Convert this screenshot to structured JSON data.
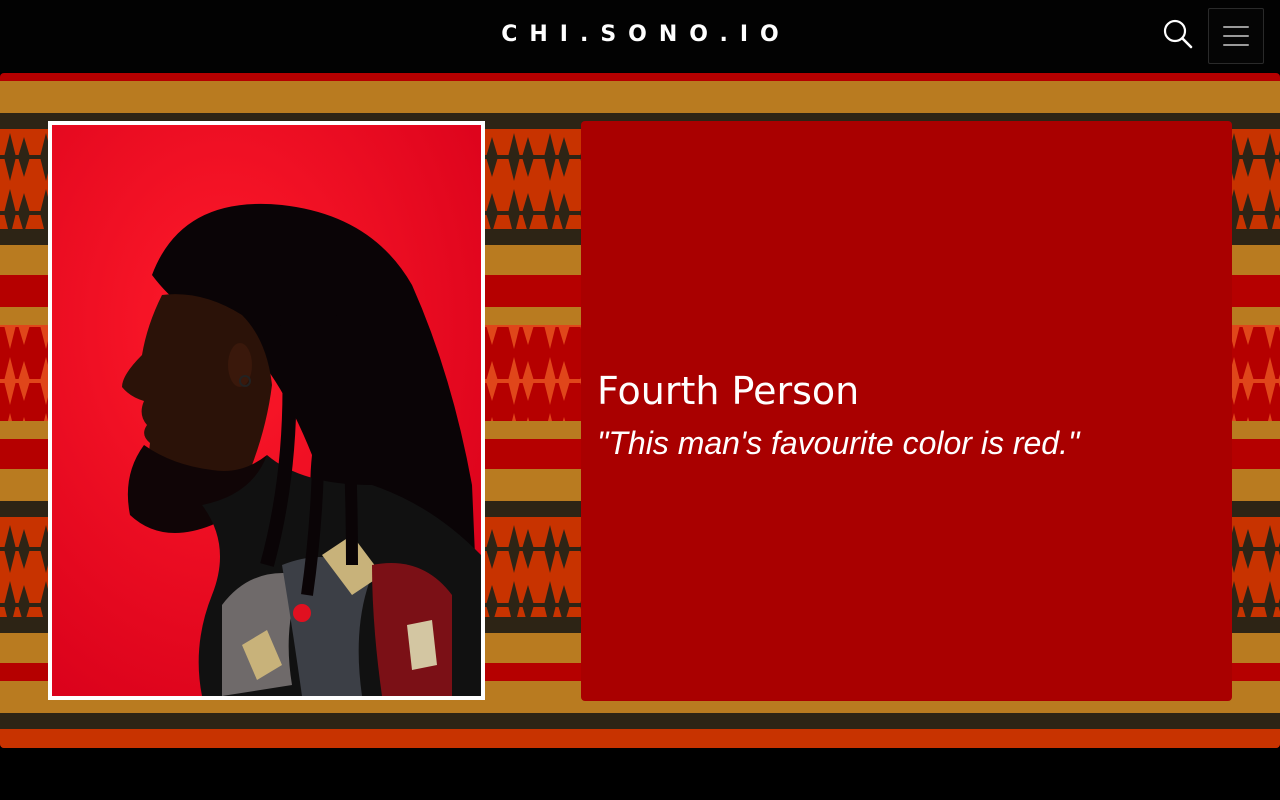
{
  "header": {
    "brand": "CHI.SONO.IO",
    "search_icon": "search-icon",
    "menu_icon": "hamburger-menu-icon"
  },
  "profile": {
    "name": "Fourth Person",
    "quote": "\"This man's favourite color is red.\"",
    "photo_description_icon": "person-portrait"
  },
  "colors": {
    "navbar_bg": "#020202",
    "card_bg": "#a90000",
    "kente_gold": "#b97b20",
    "kente_red": "#b50000",
    "kente_orange": "#c83300",
    "kente_dark": "#2d2415",
    "photo_bg": "#e8001a"
  }
}
